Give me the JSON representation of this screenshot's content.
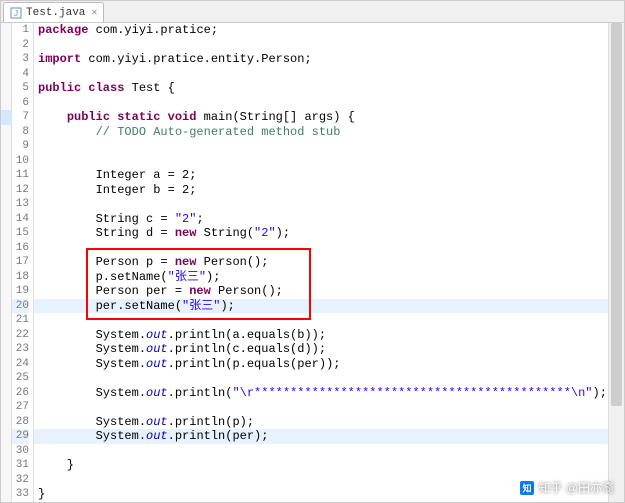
{
  "tab": {
    "filename": "Test.java",
    "close_glyph": "✕"
  },
  "lines": [
    {
      "n": 1,
      "t": [
        [
          "kw",
          "package"
        ],
        [
          "dfl",
          " com.yiyi.pratice;"
        ]
      ]
    },
    {
      "n": 2,
      "t": []
    },
    {
      "n": 3,
      "t": [
        [
          "kw",
          "import"
        ],
        [
          "dfl",
          " com.yiyi.pratice.entity.Person;"
        ]
      ]
    },
    {
      "n": 4,
      "t": []
    },
    {
      "n": 5,
      "t": [
        [
          "kw",
          "public class"
        ],
        [
          "dfl",
          " Test {"
        ]
      ]
    },
    {
      "n": 6,
      "t": []
    },
    {
      "n": 7,
      "t": [
        [
          "dfl",
          "    "
        ],
        [
          "kw",
          "public static void"
        ],
        [
          "dfl",
          " main(String[] args) {"
        ]
      ]
    },
    {
      "n": 8,
      "t": [
        [
          "dfl",
          "        "
        ],
        [
          "com",
          "// TODO Auto-generated method stub"
        ]
      ]
    },
    {
      "n": 9,
      "t": []
    },
    {
      "n": 10,
      "t": []
    },
    {
      "n": 11,
      "t": [
        [
          "dfl",
          "        Integer a = 2;"
        ]
      ]
    },
    {
      "n": 12,
      "t": [
        [
          "dfl",
          "        Integer b = 2;"
        ]
      ]
    },
    {
      "n": 13,
      "t": []
    },
    {
      "n": 14,
      "t": [
        [
          "dfl",
          "        String c = "
        ],
        [
          "str",
          "\"2\""
        ],
        [
          "dfl",
          ";"
        ]
      ]
    },
    {
      "n": 15,
      "t": [
        [
          "dfl",
          "        String d = "
        ],
        [
          "kw",
          "new"
        ],
        [
          "dfl",
          " String("
        ],
        [
          "str",
          "\"2\""
        ],
        [
          "dfl",
          ");"
        ]
      ]
    },
    {
      "n": 16,
      "t": []
    },
    {
      "n": 17,
      "t": [
        [
          "dfl",
          "        Person p = "
        ],
        [
          "kw",
          "new"
        ],
        [
          "dfl",
          " Person();"
        ]
      ]
    },
    {
      "n": 18,
      "t": [
        [
          "dfl",
          "        p.setName("
        ],
        [
          "str",
          "\"张三\""
        ],
        [
          "dfl",
          ");"
        ]
      ]
    },
    {
      "n": 19,
      "t": [
        [
          "dfl",
          "        Person per = "
        ],
        [
          "kw",
          "new"
        ],
        [
          "dfl",
          " Person();"
        ]
      ]
    },
    {
      "n": 20,
      "t": [
        [
          "dfl",
          "        per.setName("
        ],
        [
          "str",
          "\"张三\""
        ],
        [
          "dfl",
          ");"
        ]
      ]
    },
    {
      "n": 21,
      "t": []
    },
    {
      "n": 22,
      "t": [
        [
          "dfl",
          "        System."
        ],
        [
          "fld",
          "out"
        ],
        [
          "dfl",
          ".println(a.equals(b));"
        ]
      ]
    },
    {
      "n": 23,
      "t": [
        [
          "dfl",
          "        System."
        ],
        [
          "fld",
          "out"
        ],
        [
          "dfl",
          ".println(c.equals(d));"
        ]
      ]
    },
    {
      "n": 24,
      "t": [
        [
          "dfl",
          "        System."
        ],
        [
          "fld",
          "out"
        ],
        [
          "dfl",
          ".println(p.equals(per));"
        ]
      ]
    },
    {
      "n": 25,
      "t": []
    },
    {
      "n": 26,
      "t": [
        [
          "dfl",
          "        System."
        ],
        [
          "fld",
          "out"
        ],
        [
          "dfl",
          ".println("
        ],
        [
          "str",
          "\"\\r********************************************\\n\""
        ],
        [
          "dfl",
          ");"
        ]
      ]
    },
    {
      "n": 27,
      "t": []
    },
    {
      "n": 28,
      "t": [
        [
          "dfl",
          "        System."
        ],
        [
          "fld",
          "out"
        ],
        [
          "dfl",
          ".println(p);"
        ]
      ]
    },
    {
      "n": 29,
      "t": [
        [
          "dfl",
          "        System."
        ],
        [
          "fld",
          "out"
        ],
        [
          "dfl",
          ".println(per);"
        ]
      ]
    },
    {
      "n": 30,
      "t": []
    },
    {
      "n": 31,
      "t": [
        [
          "dfl",
          "    }"
        ]
      ]
    },
    {
      "n": 32,
      "t": []
    },
    {
      "n": 33,
      "t": [
        [
          "dfl",
          "}"
        ]
      ]
    }
  ],
  "highlighted_lines": [
    20,
    29
  ],
  "marker_line": 7,
  "watermark": {
    "text": "知乎 @田亦裔"
  }
}
